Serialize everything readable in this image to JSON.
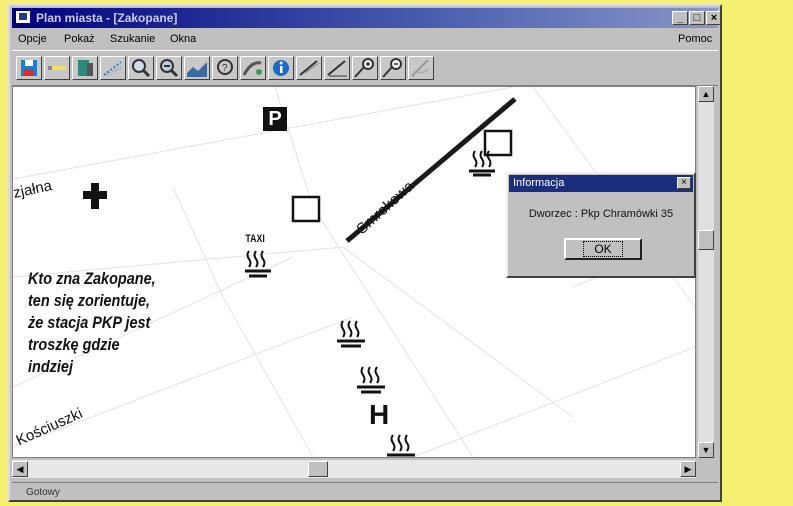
{
  "window": {
    "title": "Plan miasta - [Zakopane]"
  },
  "title_buttons": {
    "minimize": "_",
    "maximize": "□",
    "close": "×"
  },
  "menu": {
    "items": [
      "Opcje",
      "Pokaż",
      "Szukanie",
      "Okna"
    ],
    "help": "Pomoc"
  },
  "toolbar": {
    "buttons": [
      "save-icon",
      "pencil-icon",
      "book-icon",
      "dotted-icon",
      "zoom-in-icon",
      "zoom-out-icon",
      "map-icon",
      "help-icon",
      "route-icon",
      "info-icon",
      "measure-icon",
      "scale-icon",
      "zoom-in-step-icon",
      "zoom-plus-icon",
      "draw-icon"
    ]
  },
  "map": {
    "streets": [
      "zjałna",
      "Smrekowa",
      "Kościuszki"
    ],
    "parking_symbol": "P",
    "hotel_symbol": "H",
    "taxi_label": "TAXI"
  },
  "caption": {
    "lines": [
      "Kto zna Zakopane,",
      "ten się zorientuje,",
      "że stacja PKP jest",
      "troszkę gdzie",
      "indziej"
    ]
  },
  "dialog": {
    "title": "Informacja",
    "message": "Dworzec : Pkp Chramówki 35",
    "ok": "OK",
    "close": "×"
  },
  "status": {
    "text": "Gotowy"
  },
  "colors": {
    "page_background": "#f5f072",
    "titlebar": "#000080",
    "dialog_title": "#1a2e80"
  }
}
